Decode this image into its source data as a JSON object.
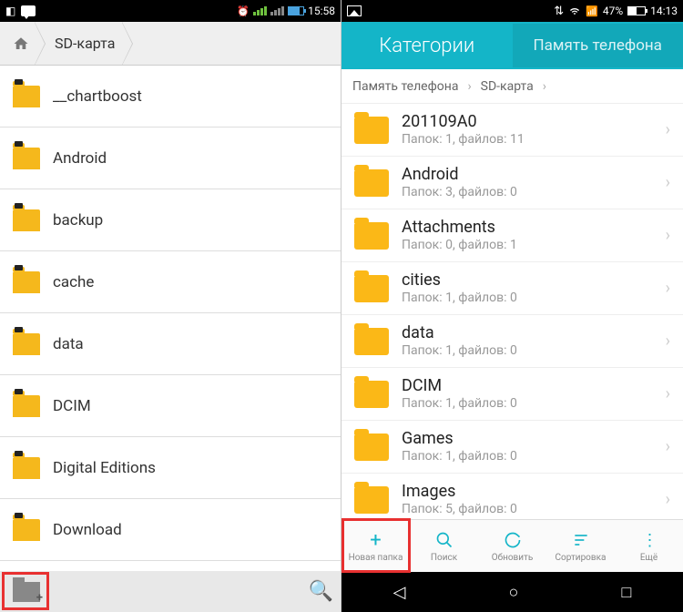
{
  "left": {
    "status": {
      "time": "15:58"
    },
    "breadcrumb": {
      "current": "SD-карта"
    },
    "folders": [
      {
        "name": "__chartboost"
      },
      {
        "name": "Android"
      },
      {
        "name": "backup"
      },
      {
        "name": "cache"
      },
      {
        "name": "data"
      },
      {
        "name": "DCIM"
      },
      {
        "name": "Digital Editions"
      },
      {
        "name": "Download"
      }
    ]
  },
  "right": {
    "status": {
      "battery": "47%",
      "time": "14:13"
    },
    "tabs": {
      "categories": "Категории",
      "memory": "Память телефона"
    },
    "breadcrumb": {
      "root": "Память телефона",
      "current": "SD-карта"
    },
    "folders": [
      {
        "name": "201109A0",
        "meta": "Папок: 1, файлов: 11"
      },
      {
        "name": "Android",
        "meta": "Папок: 3, файлов: 0"
      },
      {
        "name": "Attachments",
        "meta": "Папок: 0, файлов: 1"
      },
      {
        "name": "cities",
        "meta": "Папок: 1, файлов: 0"
      },
      {
        "name": "data",
        "meta": "Папок: 1, файлов: 0"
      },
      {
        "name": "DCIM",
        "meta": "Папок: 1, файлов: 0"
      },
      {
        "name": "Games",
        "meta": "Папок: 1, файлов: 0"
      },
      {
        "name": "Images",
        "meta": "Папок: 5, файлов: 0"
      }
    ],
    "toolbar": {
      "new_folder": "Новая папка",
      "search": "Поиск",
      "refresh": "Обновить",
      "sort": "Сортировка",
      "more": "Ещё"
    }
  }
}
